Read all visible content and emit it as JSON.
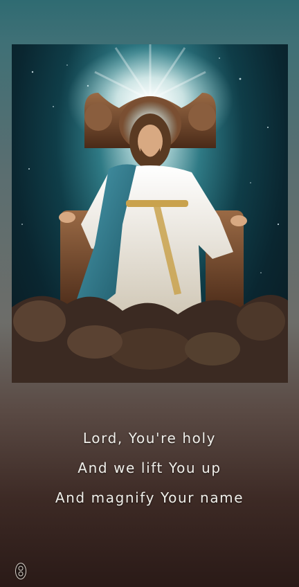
{
  "image": {
    "alt": "Jesus seated on an ornate wooden throne in white and blue robes with golden trim, beneath a radiant glow in a starry teal sky, surrounded by resting lions"
  },
  "lyrics": [
    "Lord, You're holy",
    "And we lift You up",
    "And magnify Your name"
  ],
  "colors": {
    "background_top": "#2f6b72",
    "background_bottom": "#2a1a17",
    "lyric_text": "#f0efea"
  },
  "watermark_icon": "seal-icon"
}
